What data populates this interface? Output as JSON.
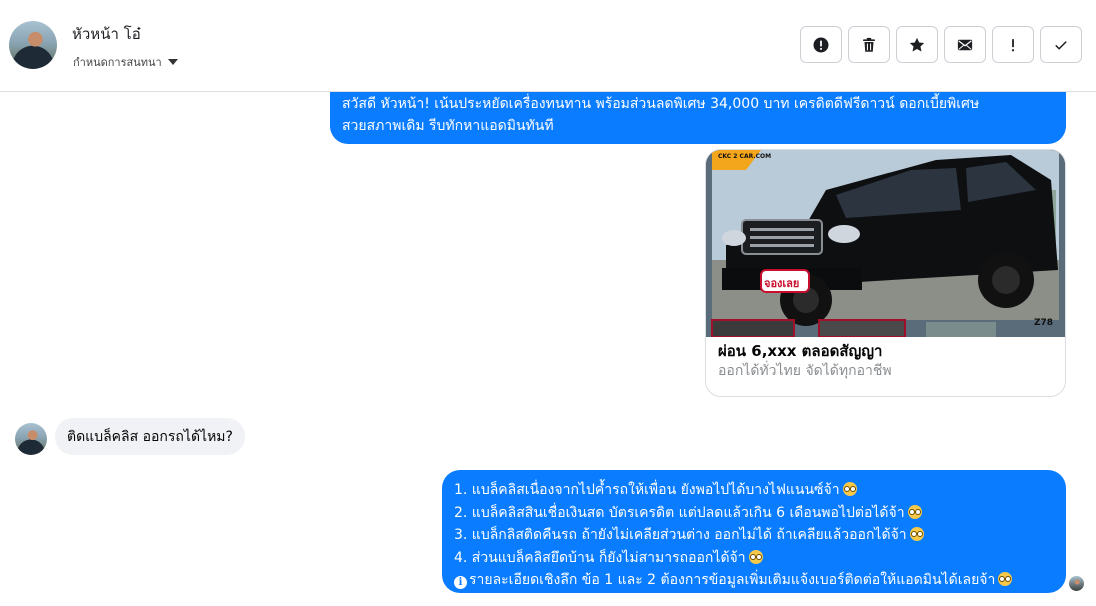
{
  "header": {
    "contact_name": "หัวหน้า โอ๋",
    "conversation_settings": "กำหนดการสนทนา",
    "toolbar": [
      {
        "name": "spam-button",
        "icon": "alert-circle-icon"
      },
      {
        "name": "delete-button",
        "icon": "trash-icon"
      },
      {
        "name": "star-button",
        "icon": "star-icon"
      },
      {
        "name": "mark-unread-button",
        "icon": "envelope-icon"
      },
      {
        "name": "follow-up-button",
        "icon": "exclamation-icon"
      },
      {
        "name": "mark-done-button",
        "icon": "check-icon"
      }
    ]
  },
  "messages": {
    "m1_line1": "สวัสดี หัวหน้า!  เน้นประหยัดเครื่องทนทาน พร้อมส่วนลดพิเศษ 34,000 บาท เครดิตดีฟรีดาวน์ ดอกเบี้ยพิเศษ",
    "m1_line2": "สวยสภาพเดิม รีบทักหาแอดมินทันที",
    "card": {
      "brand_tag": "CKC 2 CAR.COM",
      "badge": "จองเลย",
      "code": "Z78",
      "title": "ผ่อน 6,xxx ตลอดสัญญา",
      "subtitle": "ออกได้ทั่วไทย จัดได้ทุกอาชีพ"
    },
    "incoming": "ติดแบล็คลิส ออกรถได้ไหม?",
    "reply_lines": [
      "1. แบล็คลิสเนื่องจากไปค้ำรถให้เพื่อน ยังพอไปได้บางไฟแนนซ์จ้า",
      "2. แบล็คลิสสินเชื่อเงินสด บัตรเครดิต แต่ปลดแล้วเกิน 6 เดือนพอไปต่อได้จ้า",
      "3. แบล็กลิสติดคืนรถ ถ้ายังไม่เคลียส่วนต่าง ออกไม่ได้ ถ้าเคลียแล้วออกได้จ้า",
      "4. ส่วนแบล็คลิสยึดบ้าน ก็ยังไม่สามารถออกได้จ้า",
      "รายละเอียดเชิงลึก ข้อ 1 และ 2 ต้องการข้อมูลเพิ่มเติมแจ้งเบอร์ติดต่อให้แอดมินได้เลยจ้า"
    ]
  },
  "colors": {
    "accent": "#0a7cff",
    "incoming_bubble": "#f0f2f5",
    "border": "#dddfe2"
  }
}
